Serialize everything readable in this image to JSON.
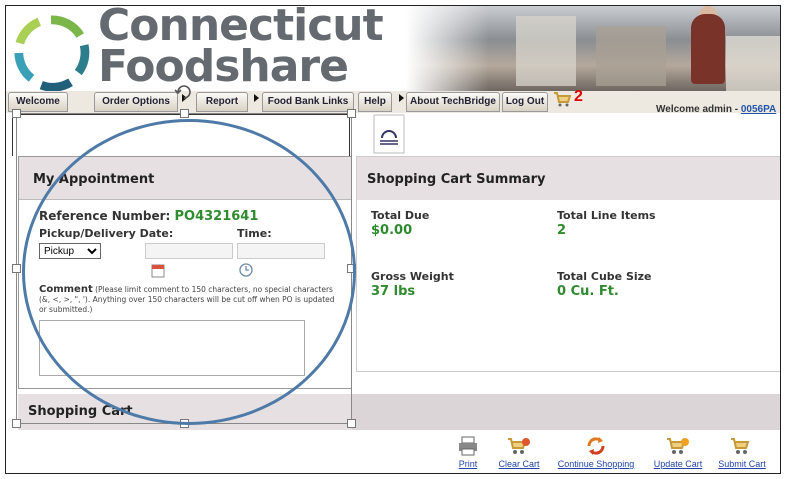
{
  "brand": {
    "line1": "Connecticut",
    "line2": "Foodshare"
  },
  "nav": {
    "tabs": [
      "Welcome",
      "Order Options",
      "Report",
      "Food Bank Links",
      "Help",
      "About TechBridge",
      "Log Out"
    ],
    "cart_count": "2",
    "welcome_text": "Welcome admin - ",
    "account_link": "0056PA"
  },
  "appointment": {
    "title": "My Appointment",
    "ref_label": "Reference Number: ",
    "ref_value": "PO4321641",
    "date_label": "Pickup/Delivery Date:",
    "time_label": "Time:",
    "mode_selected": "Pickup",
    "comment_label": "Comment",
    "comment_note": " (Please limit comment to 150 characters, no special characters (&, <, >, \", '). Anything over 150 characters will be cut off when PO is updated or submitted.)"
  },
  "summary": {
    "title": "Shopping Cart Summary",
    "total_due_label": "Total Due",
    "total_due": "$0.00",
    "line_items_label": "Total Line Items",
    "line_items": "2",
    "gross_weight_label": "Gross Weight",
    "gross_weight": "37 lbs",
    "cube_label": "Total Cube Size",
    "cube": "0 Cu. Ft."
  },
  "cart": {
    "title": "Shopping Cart",
    "actions": [
      "Print",
      "Clear Cart",
      "Continue Shopping",
      "Update Cart",
      "Submit Cart"
    ]
  },
  "colors": {
    "accent_green": "#2e8b2e",
    "annotation_circle": "#4e7aa8",
    "badge_red": "#dd0000"
  }
}
